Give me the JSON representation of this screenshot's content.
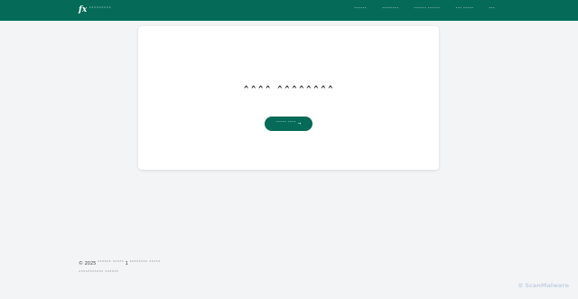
{
  "brand": {
    "icon": "fx",
    "name": "ˆˆˆˆˆˆˆˆˆ"
  },
  "nav": {
    "items": [
      {
        "label": "ˆˆˆˆˆˆ"
      },
      {
        "label": "ˆˆˆˆˆˆˆˆ"
      },
      {
        "label": "ˆˆˆˆˆˆ ˆˆˆˆˆˆ"
      },
      {
        "label": "ˆˆˆ ˆˆˆˆˆ"
      },
      {
        "label": "ˆˆˆ"
      }
    ]
  },
  "main": {
    "title": "ˆˆˆˆ ˆˆˆˆˆˆˆˆ",
    "button_label": "ˆˆˆˆˆ ˆˆˆˆ",
    "button_arrow": "→"
  },
  "footer": {
    "copyright": "© 2025 ˆˆˆˆˆˆ ˆˆˆˆˆ 1 ˆˆˆˆˆˆˆˆ ˆˆˆˆˆ",
    "tagline": "ˆˆˆˆˆˆˆˆˆˆˆ ˆˆˆˆˆˆ"
  },
  "watermark": {
    "icon": "≋",
    "text": "ScanMalware"
  },
  "colors": {
    "brand_green": "#056b58",
    "background": "#f3f4f6",
    "card": "#ffffff"
  }
}
